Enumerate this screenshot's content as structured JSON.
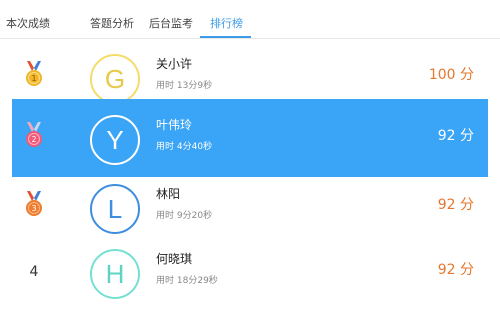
{
  "tabs": [
    {
      "label": "本次成绩",
      "active": false
    },
    {
      "label": "答题分析",
      "active": false
    },
    {
      "label": "后台监考",
      "active": false
    },
    {
      "label": "排行榜",
      "active": true
    }
  ],
  "time_prefix": "用时",
  "rows": [
    {
      "rank": "1",
      "initial": "G",
      "name": "关小许",
      "time": "13分9秒",
      "score": "100 分",
      "ring_color": "#f4dc6a",
      "initial_color": "#e8c84a",
      "medal_color": "#f1b52a",
      "highlighted": false
    },
    {
      "rank": "2",
      "initial": "Y",
      "name": "叶伟玲",
      "time": "4分40秒",
      "score": "92 分",
      "ring_color": "#ffffff",
      "initial_color": "#ffffff",
      "medal_color": "#ef5a79",
      "highlighted": true
    },
    {
      "rank": "3",
      "initial": "L",
      "name": "林阳",
      "time": "9分20秒",
      "score": "92 分",
      "ring_color": "#3d8ee0",
      "initial_color": "#3d8ee0",
      "medal_color": "#ef7b2c",
      "highlighted": false
    },
    {
      "rank": "4",
      "initial": "H",
      "name": "何晓琪",
      "time": "18分29秒",
      "score": "92 分",
      "ring_color": "#74e0d2",
      "initial_color": "#5fd3c3",
      "medal_color": "",
      "highlighted": false
    }
  ],
  "colors": {
    "accent": "#3d9be9",
    "highlight_row": "#3aa4f6",
    "score": "#e6772e"
  }
}
